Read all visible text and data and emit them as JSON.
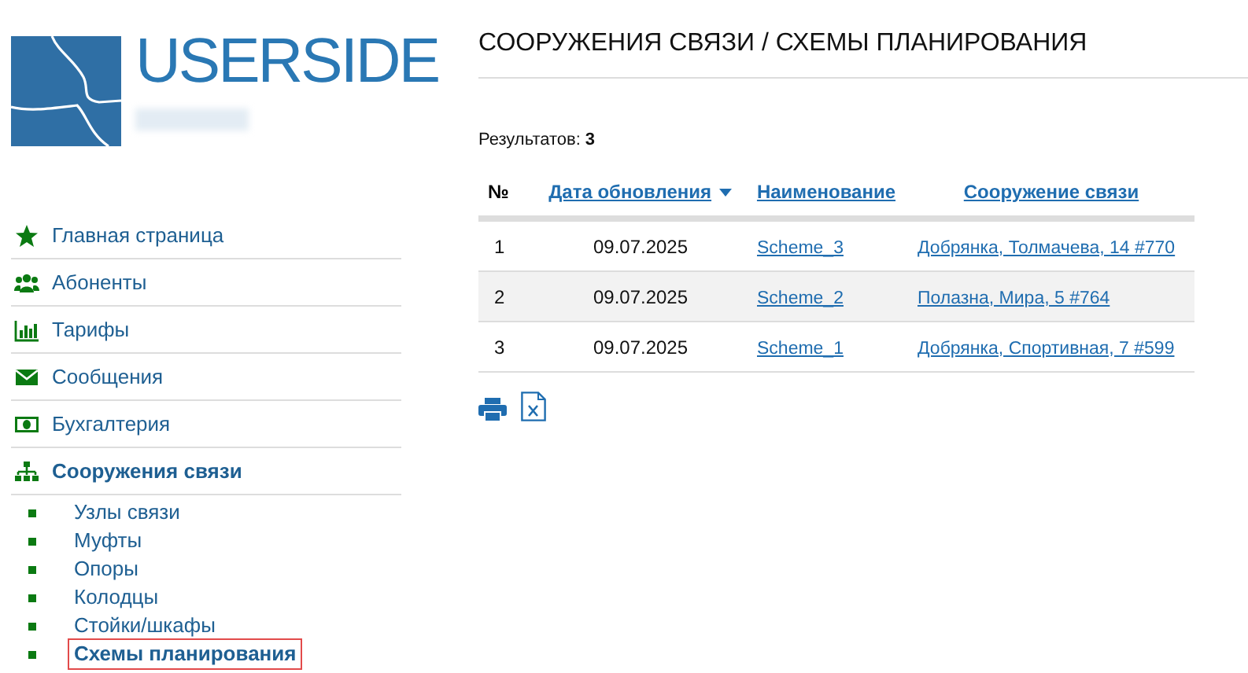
{
  "logo": {
    "text": "USERSIDE"
  },
  "menu": [
    {
      "label": "Главная страница",
      "active": false
    },
    {
      "label": "Абоненты",
      "active": false
    },
    {
      "label": "Тарифы",
      "active": false
    },
    {
      "label": "Сообщения",
      "active": false
    },
    {
      "label": "Бухгалтерия",
      "active": false
    },
    {
      "label": "Сооружения связи",
      "active": true,
      "children": [
        {
          "label": "Узлы связи",
          "selected": false
        },
        {
          "label": "Муфты",
          "selected": false
        },
        {
          "label": "Опоры",
          "selected": false
        },
        {
          "label": "Колодцы",
          "selected": false
        },
        {
          "label": "Стойки/шкафы",
          "selected": false
        },
        {
          "label": "Схемы планирования",
          "selected": true
        }
      ]
    }
  ],
  "page_title": "СООРУЖЕНИЯ СВЯЗИ / СХЕМЫ ПЛАНИРОВАНИЯ",
  "results": {
    "label": "Результатов:",
    "count": "3"
  },
  "table": {
    "columns": [
      {
        "label": "№",
        "kind": "plain",
        "sorted": false
      },
      {
        "label": "Дата обновления",
        "kind": "link",
        "sorted": true
      },
      {
        "label": "Наименование",
        "kind": "link",
        "sorted": false
      },
      {
        "label": "Сооружение связи",
        "kind": "link",
        "sorted": false
      }
    ],
    "rows": [
      [
        "1",
        "09.07.2025",
        "Scheme_3",
        "Добрянка, Толмачева, 14 #770"
      ],
      [
        "2",
        "09.07.2025",
        "Scheme_2",
        "Полазна, Мира, 5 #764"
      ],
      [
        "3",
        "09.07.2025",
        "Scheme_1",
        "Добрянка, Спортивная, 7 #599"
      ]
    ]
  }
}
